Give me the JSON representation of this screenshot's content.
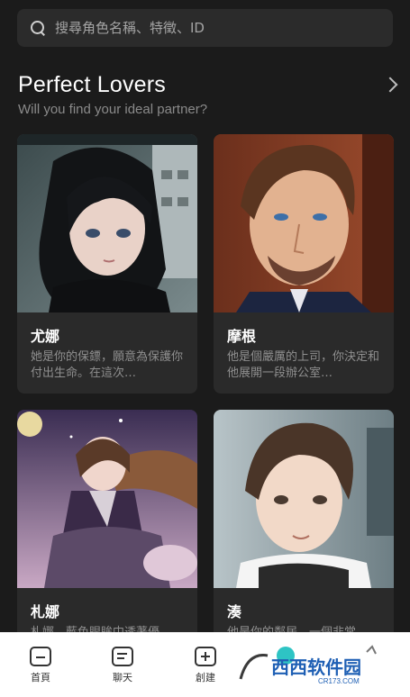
{
  "search": {
    "placeholder": "搜尋角色名稱、特徵、ID"
  },
  "section": {
    "title": "Perfect Lovers",
    "subtitle": "Will you find your ideal partner?"
  },
  "cards": [
    {
      "name": "尤娜",
      "desc": "她是你的保鏢，願意為保護你付出生命。在這次…"
    },
    {
      "name": "摩根",
      "desc": "他是個嚴厲的上司，你決定和他展開一段辦公室…"
    },
    {
      "name": "札娜",
      "desc": "札娜，藍色眼眸中透著優"
    },
    {
      "name": "湊",
      "desc": "他是你的鄰居，一個非常"
    }
  ],
  "nav": [
    {
      "label": "首頁",
      "icon": "home-icon"
    },
    {
      "label": "聊天",
      "icon": "chat-icon"
    },
    {
      "label": "創建",
      "icon": "create-icon"
    }
  ],
  "watermark": {
    "text": "西西软件园",
    "subtext": "CR173.COM"
  },
  "colors": {
    "background": "#1b1b1b",
    "card": "#2a2a2a",
    "search_bg": "#2b2b2b",
    "nav_bg": "#ffffff"
  }
}
